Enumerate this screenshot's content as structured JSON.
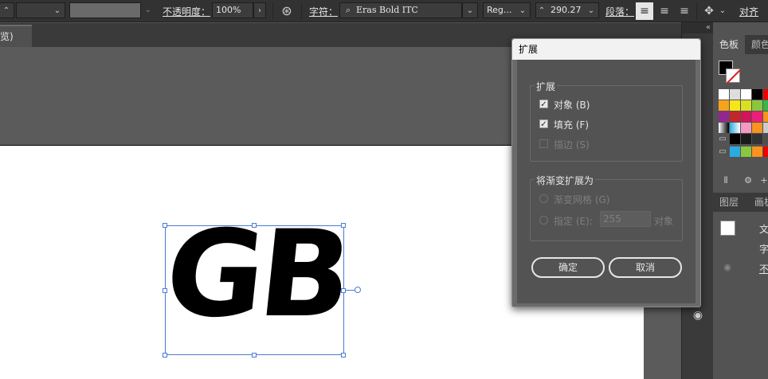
{
  "control_bar": {
    "opacity_label": "不透明度：",
    "opacity_value": "100%",
    "character_label": "字符：",
    "font_value": "Eras Bold ITC",
    "font_style_value": "Reg...",
    "font_size_value": "290.27",
    "paragraph_label": "段落：",
    "align_label": "对齐"
  },
  "document_tab": {
    "label": "览)",
    "close": "×"
  },
  "panels": {
    "swatches_tab": "色板",
    "color_tab": "颜色",
    "layers_tab": "图层",
    "artboards_tab": "画板",
    "layer_row_1": "文",
    "layer_row_2": "字",
    "layer_row_3": "不",
    "collapse_glyph": "«"
  },
  "dialog": {
    "title": "扩展",
    "group_expand": "扩展",
    "object_label": "对象 (B)",
    "fill_label": "填充 (F)",
    "stroke_label": "描边 (S)",
    "group_gradient": "将渐变扩展为",
    "gradient_mesh_label": "渐变网格 (G)",
    "specify_label": "指定 (E):",
    "specify_value": "255",
    "specify_unit": "对象",
    "ok": "确定",
    "cancel": "取消"
  },
  "artwork": {
    "text": "GB"
  },
  "colors": {
    "selection": "#4a7bd6",
    "ui_dark": "#323232",
    "dialog_bg": "#535353"
  }
}
